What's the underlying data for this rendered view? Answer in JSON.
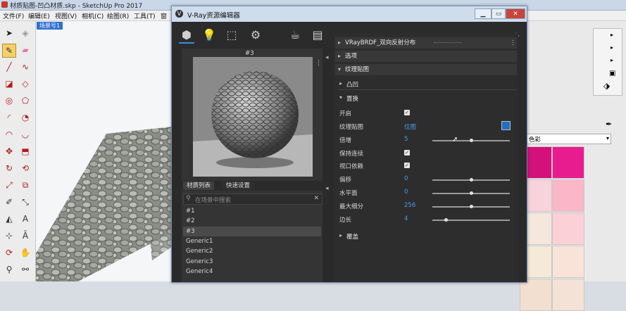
{
  "sketchup": {
    "title": "材质贴图-凹凸材质.skp - SketchUp Pro 2017",
    "menu": [
      "文件(F)",
      "编辑(E)",
      "视图(V)",
      "相机(C)",
      "绘图(R)",
      "工具(T)",
      "窗"
    ],
    "scene_tab": "场景号1",
    "tray_dropdown": "色彩",
    "swatches": [
      "#d4107a",
      "#e81c8f",
      "#f8d3dc",
      "#fbb6c8",
      "#f6e7dd",
      "#fbd0d6",
      "#f5ead7",
      "#f9e3d8",
      "#f2dfcf",
      "#f4e2d6"
    ]
  },
  "vray": {
    "title": "V-Ray资源编辑器",
    "preview_name": "#3",
    "tabs": [
      "材质列表",
      "快速设置"
    ],
    "search_placeholder": "在场景中搜索",
    "materials": [
      "#1",
      "#2",
      "#3",
      "Generic1",
      "Generic2",
      "Generic3",
      "Generic4"
    ],
    "selected_material": "#3",
    "brdf_header": "VRayBRDF_双向反射分布",
    "options_header": "选项",
    "maps_header": "纹理贴图",
    "bump_header": "凸凹",
    "displacement_header": "置换",
    "override_header": "覆盖",
    "props": {
      "enable_label": "开启",
      "texture_label": "纹理贴图",
      "texture_value": "位图",
      "multiplier_label": "倍增",
      "multiplier_value": "5",
      "keep_continuity_label": "保持连续",
      "viewport_label": "视口依赖",
      "shift_label": "偏移",
      "shift_value": "0",
      "water_level_label": "水平面",
      "water_level_value": "0",
      "max_subdiv_label": "最大细分",
      "max_subdiv_value": "256",
      "edge_length_label": "边长",
      "edge_length_value": "4"
    },
    "checkboxes": {
      "enable": true,
      "keep_continuity": true,
      "viewport": true
    },
    "sliders": {
      "multiplier": 0.5,
      "shift": 0.5,
      "water_level": 0.5,
      "max_subdiv": 0.5,
      "edge_length": 0.17
    },
    "accent": "#4d9ee8"
  }
}
